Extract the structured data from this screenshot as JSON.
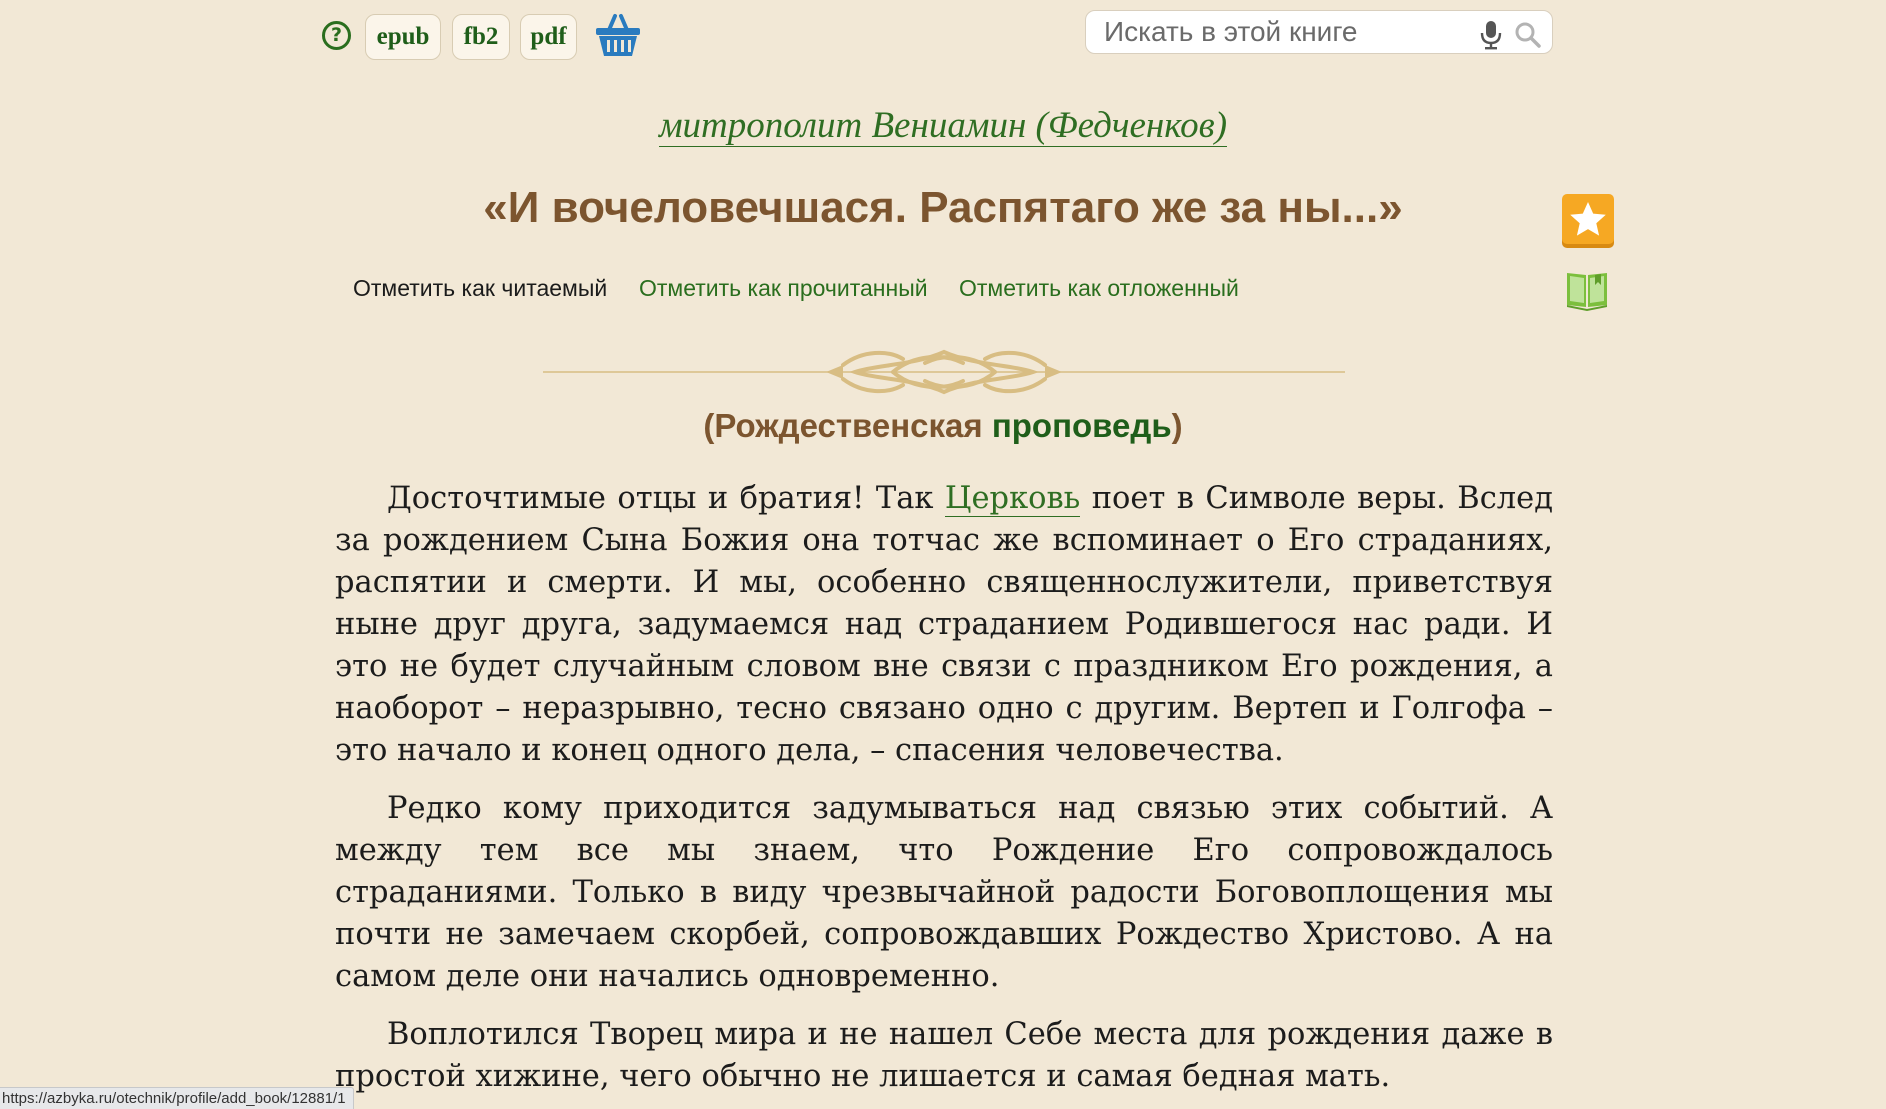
{
  "toolbar": {
    "help_label": "?",
    "formats": [
      "epub",
      "fb2",
      "pdf"
    ],
    "basket_icon": "basket-icon"
  },
  "search": {
    "placeholder": "Искать в этой книге",
    "value": "",
    "mic_icon": "microphone-icon",
    "search_icon": "magnifier-icon"
  },
  "book": {
    "author": "митрополит Вениамин (Федченков)",
    "title": "«И вочеловечшася. Распятаго же за ны...»"
  },
  "side_icons": {
    "favorite": "star-icon",
    "reader": "open-book-icon",
    "accent": "#f5a623",
    "book_color": "#7cbf3d"
  },
  "mark_links": {
    "reading": "Отметить как читаемый",
    "read": "Отметить как прочитанный",
    "postponed": "Отметить как отложенный"
  },
  "section": {
    "open": "(",
    "word1": "Рождественская ",
    "word2": "проповедь",
    "close": ")"
  },
  "paragraphs": [
    {
      "before": "Досточтимые отцы и братия! Так ",
      "link": "Церковь",
      "after": " поет в Символе веры. Вслед за рождением Сына Божия она тотчас же вспоминает о Его страданиях, распятии и смерти. И мы, особенно священнослужители, приветствуя ныне друг друга, задумаемся над страданием Родившегося нас ради. И это не будет случайным словом вне связи с праздником Его рождения, а наоборот – неразрывно, тесно связано одно с другим. Вертеп и Голгофа – это начало и конец одного дела, – спасения человечества."
    },
    {
      "text": "Редко кому приходится задумываться над связью этих событий. А между тем все мы знаем, что Рождение Его сопровождалось страданиями. Только в виду чрезвычайной радости Боговоплощения мы почти не замечаем скорбей, сопровождавших Рождество Христово. А на самом деле они начались одновременно."
    },
    {
      "text": "Воплотился Творец мира и не нашел Себе места для рождения даже в простой хижине, чего обычно не лишается и самая бедная мать."
    }
  ],
  "status_bar": {
    "url": "https://azbyka.ru/otechnik/profile/add_book/12881/1"
  },
  "colors": {
    "background": "#f2e8d6",
    "link_green": "#2f6e23",
    "title_brown": "#7c552f",
    "ornament_gold": "#d8bd83"
  }
}
